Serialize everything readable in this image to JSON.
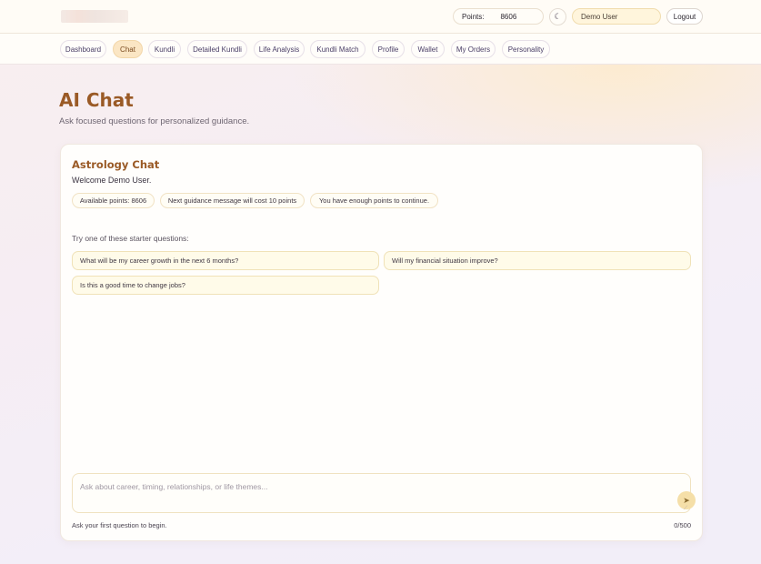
{
  "header": {
    "points_label": "Points:",
    "points_value": "8606",
    "theme_icon": "moon-icon",
    "user_name": "Demo User",
    "logout_label": "Logout"
  },
  "nav": {
    "tabs": [
      {
        "label": "Dashboard",
        "active": false
      },
      {
        "label": "Chat",
        "active": true
      },
      {
        "label": "Kundli",
        "active": false
      },
      {
        "label": "Detailed Kundli",
        "active": false
      },
      {
        "label": "Life Analysis",
        "active": false
      },
      {
        "label": "Kundli Match",
        "active": false
      },
      {
        "label": "Profile",
        "active": false
      },
      {
        "label": "Wallet",
        "active": false
      },
      {
        "label": "My Orders",
        "active": false
      },
      {
        "label": "Personality",
        "active": false
      }
    ]
  },
  "page": {
    "title": "AI Chat",
    "subtitle": "Ask focused questions for personalized guidance."
  },
  "chat": {
    "title": "Astrology Chat",
    "welcome": "Welcome Demo User.",
    "info": [
      "Available points: 8606",
      "Next guidance message will cost 10 points",
      "You have enough points to continue."
    ],
    "starter_label": "Try one of these starter questions:",
    "starters": [
      "What will be my career growth in the next 6 months?",
      "Will my financial situation improve?",
      "Is this a good time to change jobs?"
    ],
    "input_placeholder": "Ask about career, timing, relationships, or life themes...",
    "input_value": "",
    "send_icon": "send-icon",
    "hint": "Ask your first question to begin.",
    "counter": "0/500"
  },
  "colors": {
    "accent": "#9a5a26",
    "active_tab_bg": "#fbe6c4",
    "starter_bg": "#fffbe9"
  }
}
